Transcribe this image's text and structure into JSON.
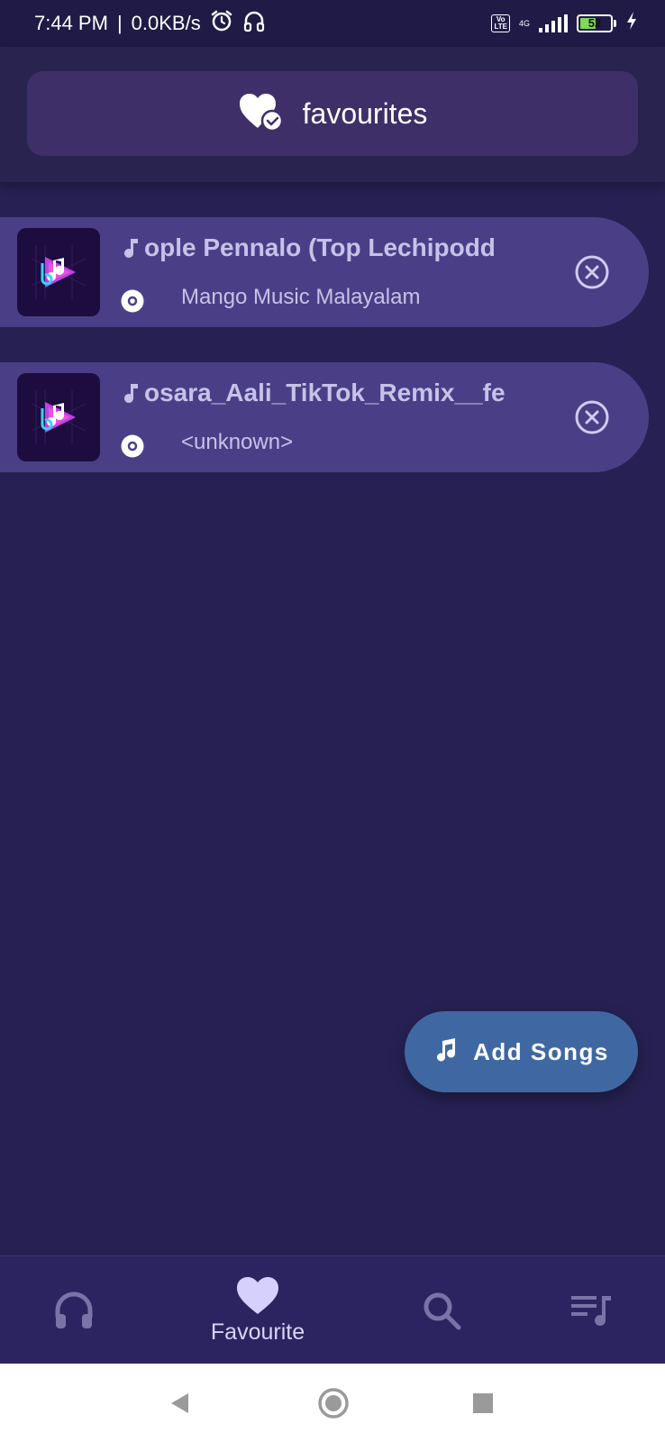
{
  "status_bar": {
    "time": "7:44 PM",
    "separator": "|",
    "speed": "0.0KB/s",
    "volte": "Vo LTE",
    "network": "4G",
    "battery_percent": "52",
    "battery_level": 0.52,
    "icons": [
      "alarm-icon",
      "headset-icon",
      "signal-icon",
      "battery-icon",
      "charging-icon"
    ]
  },
  "header": {
    "title": "favourites",
    "icon": "heart-check-icon"
  },
  "songs": [
    {
      "title": "ople Pennalo (Top Lechipodd",
      "artist": "Mango Music Malayalam"
    },
    {
      "title": "osara_Aali_TikTok_Remix__fe",
      "artist": "<unknown>"
    }
  ],
  "fab": {
    "label": "Add Songs",
    "icon": "music-note-icon"
  },
  "bottom_nav": {
    "items": [
      {
        "icon": "headphones-icon",
        "label": ""
      },
      {
        "icon": "heart-icon",
        "label": "Favourite",
        "active": true
      },
      {
        "icon": "search-icon",
        "label": ""
      },
      {
        "icon": "playlist-icon",
        "label": ""
      }
    ]
  },
  "system_nav": [
    "back-icon",
    "home-icon",
    "recents-icon"
  ],
  "colors": {
    "background": "#262152",
    "header_card": "#3f2f69",
    "song_row": "#4a3f86",
    "fab": "#3f68a3",
    "bottom_nav": "#2c2460",
    "active_icon": "#d5d0ff",
    "inactive_icon": "#7a73a8"
  }
}
